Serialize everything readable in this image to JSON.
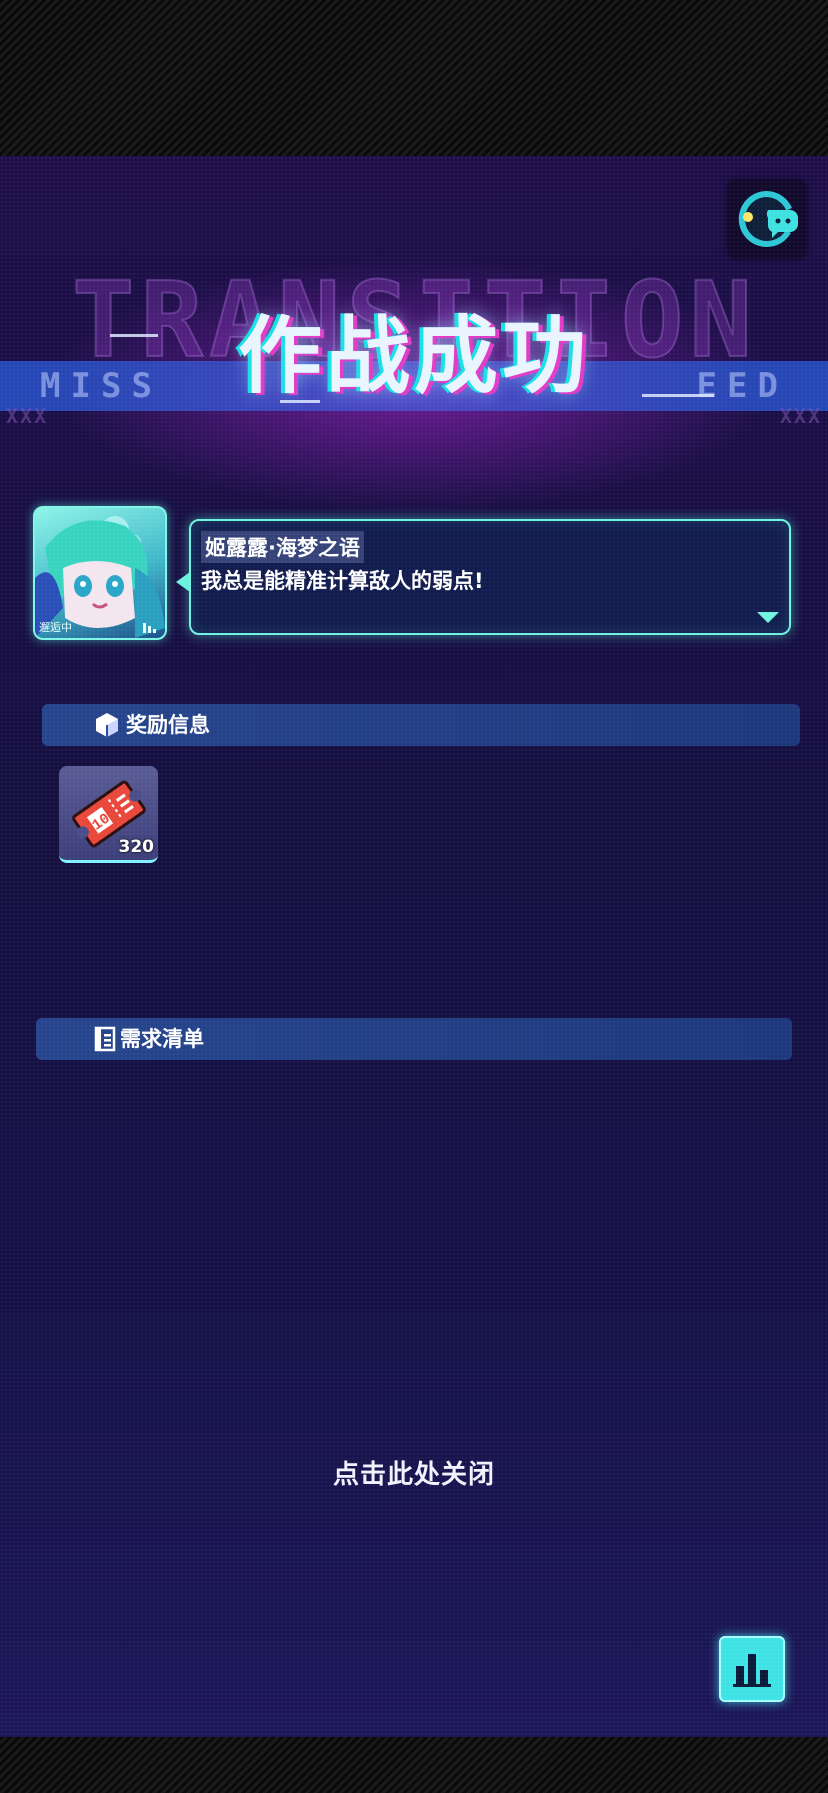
{
  "background_word": "TRANSITION",
  "mission_text": [
    "M",
    "I",
    "S",
    "S",
    "",
    "",
    "",
    "",
    "",
    "",
    "",
    "",
    "E",
    "E",
    "D"
  ],
  "title": "作战成功",
  "decor_xxx": "XXX",
  "character": {
    "name": "姬露露·海梦之语",
    "line": "我总是能精准计算敌人的弱点!",
    "status": "邂逅中"
  },
  "sections": {
    "rewards_label": "奖励信息",
    "requirements_label": "需求清单"
  },
  "reward_item": {
    "icon": "ticket-icon",
    "count": "320"
  },
  "close_label": "点击此处关闭",
  "colors": {
    "accent_cyan": "#6ff3e0",
    "title_glow_magenta": "#e03cc8",
    "bg_top": "#1e0f4a"
  }
}
